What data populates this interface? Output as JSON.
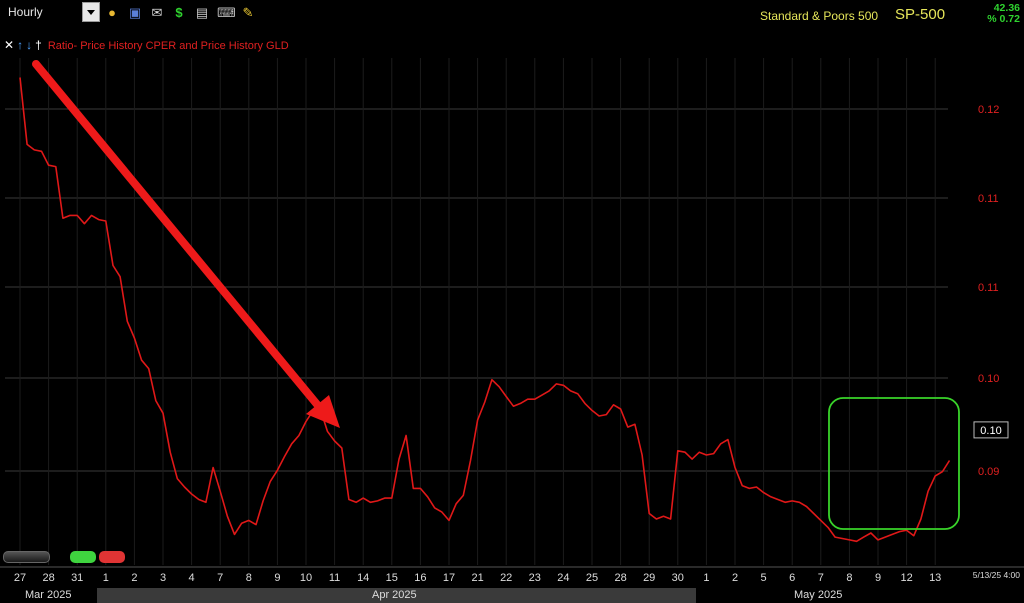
{
  "toolbar": {
    "interval": "Hourly",
    "icons": [
      "dropdown-icon",
      "lock-icon",
      "save-icon",
      "mail-icon",
      "dollar-icon",
      "print-icon",
      "keyboard-icon",
      "pencil-icon"
    ]
  },
  "header": {
    "index_name": "Standard & Poors 500",
    "symbol": "SP-500",
    "change": "42.36",
    "change_pct": "% 0.72"
  },
  "legend": {
    "controls": [
      "x",
      "up",
      "down",
      "pin"
    ],
    "text": "Ratio-  Price History CPER and  Price History GLD"
  },
  "colors": {
    "series": "#e01818",
    "arrow": "#ee1a1a",
    "highlight": "#39d42a",
    "grid": "#3a3a3a",
    "header": "#e6e65a",
    "change": "#2fd32f"
  },
  "chart_data": {
    "type": "line",
    "y_tick_labels": [
      "0.12",
      "0.11",
      "0.11",
      "0.10",
      "0.09"
    ],
    "ylim": [
      0.0865,
      0.1229
    ],
    "last_value_label": "0.10",
    "last_timestamp": "5/13/25 4:00",
    "x_tick_labels": [
      "27",
      "28",
      "31",
      "1",
      "2",
      "3",
      "4",
      "7",
      "8",
      "9",
      "10",
      "11",
      "14",
      "15",
      "16",
      "17",
      "21",
      "22",
      "23",
      "24",
      "25",
      "28",
      "29",
      "30",
      "1",
      "2",
      "5",
      "6",
      "7",
      "8",
      "9",
      "12",
      "13"
    ],
    "months": [
      "Mar 2025",
      "Apr 2025",
      "May 2025"
    ],
    "x": [
      0,
      0.25,
      0.5,
      0.75,
      1,
      1.25,
      1.5,
      1.75,
      2,
      2.25,
      2.5,
      2.75,
      3,
      3.25,
      3.5,
      3.75,
      4,
      4.25,
      4.5,
      4.75,
      5,
      5.25,
      5.5,
      5.75,
      6,
      6.25,
      6.5,
      6.75,
      7,
      7.25,
      7.5,
      7.75,
      8,
      8.25,
      8.5,
      8.75,
      9,
      9.25,
      9.5,
      9.75,
      10,
      10.25,
      10.5,
      10.75,
      11,
      11.25,
      11.5,
      11.75,
      12,
      12.25,
      12.5,
      12.75,
      13,
      13.25,
      13.5,
      13.75,
      14,
      14.25,
      14.5,
      14.75,
      15,
      15.25,
      15.5,
      15.75,
      16,
      16.25,
      16.5,
      16.75,
      17,
      17.25,
      17.5,
      17.75,
      18,
      18.25,
      18.5,
      18.75,
      19,
      19.25,
      19.5,
      19.75,
      20,
      20.25,
      20.5,
      20.75,
      21,
      21.25,
      21.5,
      21.75,
      22,
      22.25,
      22.5,
      22.75,
      23,
      23.25,
      23.5,
      23.75,
      24,
      24.25,
      24.5,
      24.75,
      25,
      25.25,
      25.5,
      25.75,
      26,
      26.25,
      26.5,
      26.75,
      27,
      27.25,
      27.5,
      27.75,
      28,
      28.25,
      28.5,
      28.75,
      29,
      29.25,
      29.5,
      29.75,
      30,
      30.25,
      30.5,
      30.75,
      31,
      31.25,
      31.5,
      31.75,
      32,
      32.25,
      32.5
    ],
    "values": [
      0.1215,
      0.1167,
      0.1163,
      0.1162,
      0.1152,
      0.1151,
      0.1114,
      0.1116,
      0.1116,
      0.111,
      0.1116,
      0.1113,
      0.1112,
      0.108,
      0.1072,
      0.104,
      0.1028,
      0.1012,
      0.1006,
      0.0983,
      0.0974,
      0.0946,
      0.0927,
      0.0921,
      0.0916,
      0.0912,
      0.091,
      0.0935,
      0.0918,
      0.09,
      0.0887,
      0.0895,
      0.0897,
      0.0894,
      0.0911,
      0.0925,
      0.0933,
      0.0943,
      0.0952,
      0.0958,
      0.0968,
      0.0976,
      0.0977,
      0.0961,
      0.0954,
      0.0949,
      0.0912,
      0.091,
      0.0913,
      0.091,
      0.0911,
      0.0913,
      0.0913,
      0.0941,
      0.0958,
      0.092,
      0.092,
      0.0914,
      0.0906,
      0.0903,
      0.0897,
      0.0909,
      0.0915,
      0.094,
      0.0969,
      0.0982,
      0.0998,
      0.0993,
      0.0986,
      0.0979,
      0.0981,
      0.0984,
      0.0984,
      0.0987,
      0.099,
      0.0995,
      0.0994,
      0.099,
      0.0988,
      0.0981,
      0.0976,
      0.0972,
      0.0973,
      0.098,
      0.0977,
      0.0964,
      0.0966,
      0.0944,
      0.0902,
      0.0898,
      0.09,
      0.0898,
      0.0947,
      0.0946,
      0.0941,
      0.0946,
      0.0944,
      0.0945,
      0.0952,
      0.0955,
      0.0935,
      0.0922,
      0.092,
      0.0921,
      0.0917,
      0.0914,
      0.0912,
      0.091,
      0.0911,
      0.091,
      0.0907,
      0.0902,
      0.0897,
      0.0892,
      0.0885,
      0.0884,
      0.0883,
      0.0882,
      0.0885,
      0.0888,
      0.0883,
      0.0885,
      0.0887,
      0.0889,
      0.089,
      0.0886,
      0.0898,
      0.0918,
      0.0929,
      0.0932,
      0.094,
      0.0957,
      0.0962
    ]
  }
}
